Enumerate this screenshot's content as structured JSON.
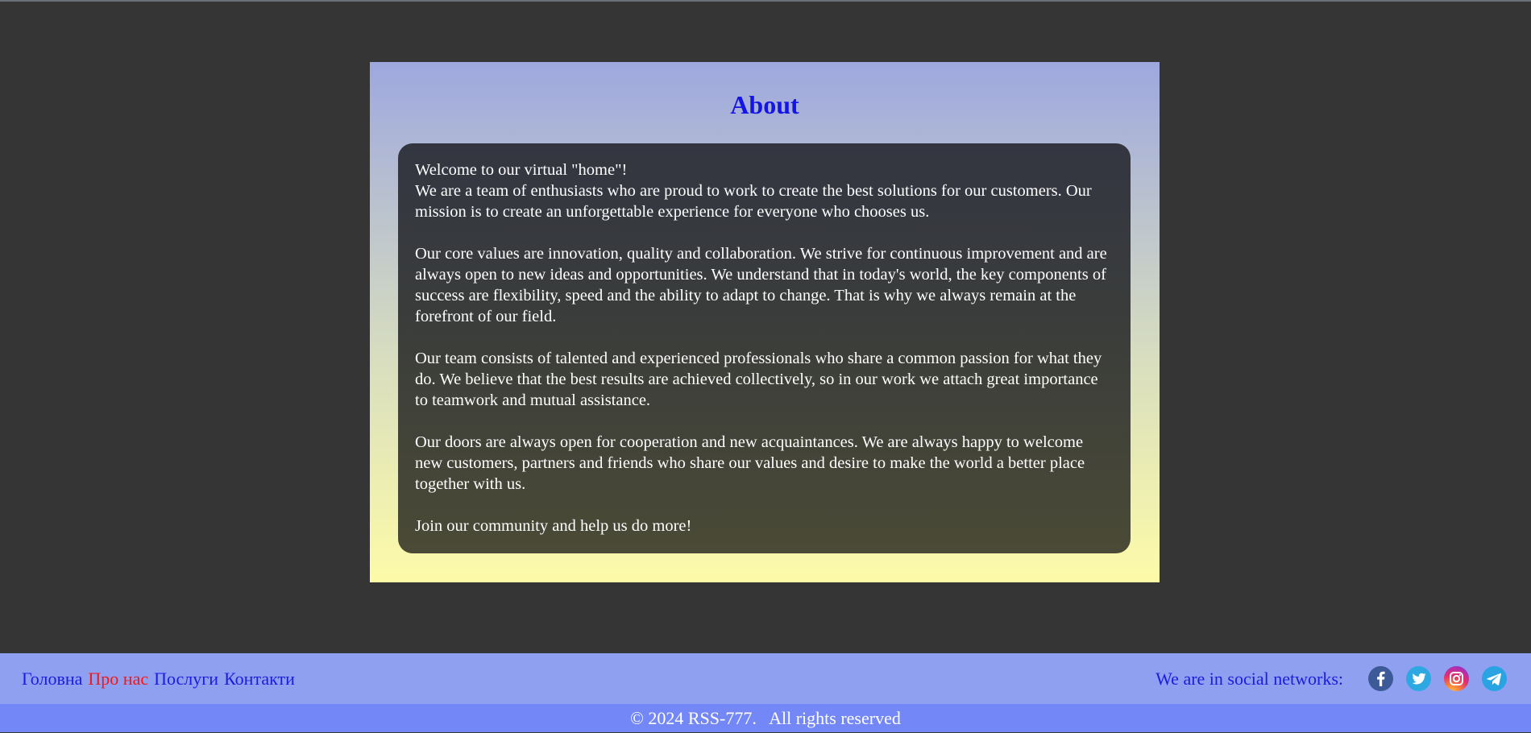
{
  "about": {
    "title": "About",
    "paragraphs": [
      {
        "line1": "Welcome to our virtual \"home\"!",
        "line2": "We are a team of enthusiasts who are proud to work to create the best solutions for our customers. Our mission is to create an unforgettable experience for everyone who chooses us."
      },
      "Our core values are innovation, quality and collaboration. We strive for continuous improvement and are always open to new ideas and opportunities. We understand that in today's world, the key components of success are flexibility, speed and the ability to adapt to change. That is why we always remain at the forefront of our field.",
      "Our team consists of talented and experienced professionals who share a common passion for what they do. We believe that the best results are achieved collectively, so in our work we attach great importance to teamwork and mutual assistance.",
      "Our doors are always open for cooperation and new acquaintances. We are always happy to welcome new customers, partners and friends who share our values and desire to make the world a better place together with us.",
      "Join our community and help us do more!"
    ]
  },
  "nav": {
    "items": [
      {
        "label": "Головна",
        "active": false
      },
      {
        "label": "Про нас",
        "active": true
      },
      {
        "label": "Послуги",
        "active": false
      },
      {
        "label": "Контакти",
        "active": false
      }
    ]
  },
  "social": {
    "label": "We are in social networks:",
    "icons": [
      "facebook-icon",
      "twitter-icon",
      "instagram-icon",
      "telegram-icon"
    ]
  },
  "footer": {
    "text": "© 2024 RSS-777.   All rights reserved"
  },
  "colors": {
    "page_background": "#353535",
    "title": "#1414e6",
    "nav_link": "#1c1ce0",
    "nav_active": "#f01818",
    "nav_bar": "#8fa0f1",
    "footer_bar": "#7487f7"
  }
}
